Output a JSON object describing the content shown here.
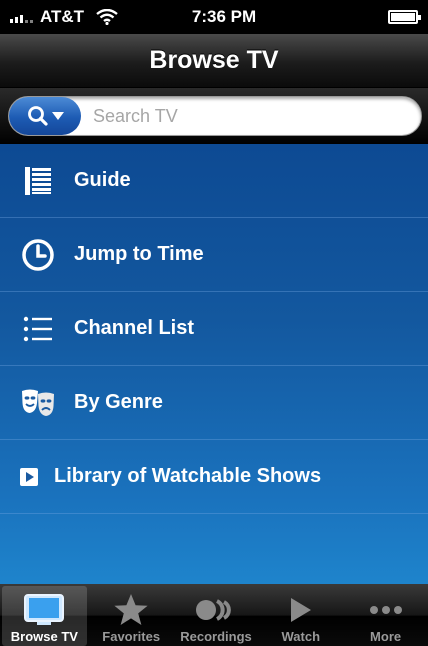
{
  "status_bar": {
    "carrier": "AT&T",
    "time": "7:36 PM"
  },
  "nav": {
    "title": "Browse TV"
  },
  "search": {
    "placeholder": "Search TV",
    "value": ""
  },
  "menu": {
    "items": [
      {
        "label": "Guide",
        "icon": "guide-list-icon"
      },
      {
        "label": "Jump to Time",
        "icon": "clock-icon"
      },
      {
        "label": "Channel List",
        "icon": "bulleted-list-icon"
      },
      {
        "label": "By Genre",
        "icon": "theater-masks-icon"
      },
      {
        "label": "Library of Watchable Shows",
        "icon": "play-icon"
      }
    ]
  },
  "tabs": [
    {
      "label": "Browse TV",
      "icon": "tv-icon",
      "active": true
    },
    {
      "label": "Favorites",
      "icon": "star-icon",
      "active": false
    },
    {
      "label": "Recordings",
      "icon": "recordings-icon",
      "active": false
    },
    {
      "label": "Watch",
      "icon": "play-icon",
      "active": false
    },
    {
      "label": "More",
      "icon": "more-dots-icon",
      "active": false
    }
  ],
  "colors": {
    "accent": "#1d5bb3",
    "menu_top": "#0d4a93",
    "menu_bottom": "#1e84cc"
  }
}
